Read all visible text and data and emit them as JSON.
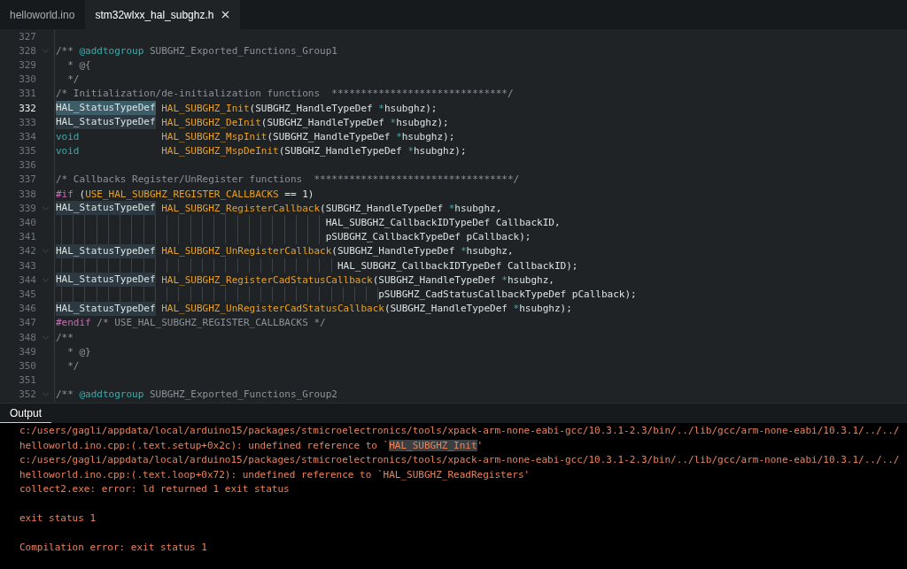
{
  "tabs": [
    {
      "label": "helloworld.ino",
      "selected": false
    },
    {
      "label": "stm32wlxx_hal_subghz.h",
      "selected": true
    }
  ],
  "editor": {
    "lines": [
      {
        "number": "327",
        "current": false,
        "fold": false
      },
      {
        "number": "328",
        "current": false,
        "fold": true,
        "tokens": [
          {
            "kind": "comment",
            "text": "/** "
          },
          {
            "kind": "tag",
            "text": "@addtogroup"
          },
          {
            "kind": "comment",
            "text": " SUBGHZ_Exported_Functions_Group1"
          }
        ]
      },
      {
        "number": "329",
        "current": false,
        "fold": false,
        "tokens": [
          {
            "kind": "comment",
            "text": "  * @{"
          }
        ]
      },
      {
        "number": "330",
        "current": false,
        "fold": false,
        "tokens": [
          {
            "kind": "comment",
            "text": "  */"
          }
        ]
      },
      {
        "number": "331",
        "current": false,
        "fold": false,
        "tokens": [
          {
            "kind": "comment",
            "text": "/* Initialization/de-initialization functions  ******************************/"
          }
        ]
      },
      {
        "number": "332",
        "current": true,
        "fold": false,
        "tokens": [
          {
            "kind": "type",
            "text": "HAL_StatusTypeDef",
            "highlighted": true
          },
          {
            "kind": "func",
            "text": " HAL_SUBGHZ_Init"
          },
          {
            "kind": "text",
            "text": "(SUBGHZ_HandleTypeDef "
          },
          {
            "kind": "op",
            "text": "*"
          },
          {
            "kind": "text",
            "text": "hsubghz);"
          }
        ]
      },
      {
        "number": "333",
        "current": false,
        "fold": false,
        "tokens": [
          {
            "kind": "type",
            "text": "HAL_StatusTypeDef",
            "highlighted": true
          },
          {
            "kind": "func",
            "text": " HAL_SUBGHZ_DeInit"
          },
          {
            "kind": "text",
            "text": "(SUBGHZ_HandleTypeDef "
          },
          {
            "kind": "op",
            "text": "*"
          },
          {
            "kind": "text",
            "text": "hsubghz);"
          }
        ]
      },
      {
        "number": "334",
        "current": false,
        "fold": false,
        "tokens": [
          {
            "kind": "keyword",
            "text": "void"
          },
          {
            "kind": "func",
            "text": "              HAL_SUBGHZ_MspInit"
          },
          {
            "kind": "text",
            "text": "(SUBGHZ_HandleTypeDef "
          },
          {
            "kind": "op",
            "text": "*"
          },
          {
            "kind": "text",
            "text": "hsubghz);"
          }
        ]
      },
      {
        "number": "335",
        "current": false,
        "fold": false,
        "tokens": [
          {
            "kind": "keyword",
            "text": "void"
          },
          {
            "kind": "func",
            "text": "              HAL_SUBGHZ_MspDeInit"
          },
          {
            "kind": "text",
            "text": "(SUBGHZ_HandleTypeDef "
          },
          {
            "kind": "op",
            "text": "*"
          },
          {
            "kind": "text",
            "text": "hsubghz);"
          }
        ]
      },
      {
        "number": "336",
        "current": false,
        "fold": false
      },
      {
        "number": "337",
        "current": false,
        "fold": false,
        "tokens": [
          {
            "kind": "comment",
            "text": "/* Callbacks Register/UnRegister functions  **********************************/"
          }
        ]
      },
      {
        "number": "338",
        "current": false,
        "fold": false,
        "tokens": [
          {
            "kind": "directive",
            "text": "#if"
          },
          {
            "kind": "text",
            "text": " ("
          },
          {
            "kind": "func",
            "text": "USE_HAL_SUBGHZ_REGISTER_CALLBACKS"
          },
          {
            "kind": "text",
            "text": " == 1)"
          }
        ]
      },
      {
        "number": "339",
        "current": false,
        "fold": true,
        "tokens": [
          {
            "kind": "type",
            "text": "HAL_StatusTypeDef",
            "highlighted": true
          },
          {
            "kind": "func",
            "text": " HAL_SUBGHZ_RegisterCallback"
          },
          {
            "kind": "text",
            "text": "(SUBGHZ_HandleTypeDef "
          },
          {
            "kind": "op",
            "text": "*"
          },
          {
            "kind": "text",
            "text": "hsubghz,"
          }
        ]
      },
      {
        "number": "340",
        "current": false,
        "fold": false,
        "tokens": [
          {
            "kind": "continuation",
            "text": "                                              HAL_SUBGHZ_CallbackIDTypeDef CallbackID,"
          }
        ]
      },
      {
        "number": "341",
        "current": false,
        "fold": false,
        "tokens": [
          {
            "kind": "continuation",
            "text": "                                              pSUBGHZ_CallbackTypeDef pCallback);"
          }
        ]
      },
      {
        "number": "342",
        "current": false,
        "fold": true,
        "tokens": [
          {
            "kind": "type",
            "text": "HAL_StatusTypeDef",
            "highlighted": true
          },
          {
            "kind": "func",
            "text": " HAL_SUBGHZ_UnRegisterCallback"
          },
          {
            "kind": "text",
            "text": "(SUBGHZ_HandleTypeDef "
          },
          {
            "kind": "op",
            "text": "*"
          },
          {
            "kind": "text",
            "text": "hsubghz,"
          }
        ]
      },
      {
        "number": "343",
        "current": false,
        "fold": false,
        "tokens": [
          {
            "kind": "continuation",
            "text": "                                                HAL_SUBGHZ_CallbackIDTypeDef CallbackID);"
          }
        ]
      },
      {
        "number": "344",
        "current": false,
        "fold": true,
        "tokens": [
          {
            "kind": "type",
            "text": "HAL_StatusTypeDef",
            "highlighted": true
          },
          {
            "kind": "func",
            "text": " HAL_SUBGHZ_RegisterCadStatusCallback"
          },
          {
            "kind": "text",
            "text": "(SUBGHZ_HandleTypeDef "
          },
          {
            "kind": "op",
            "text": "*"
          },
          {
            "kind": "text",
            "text": "hsubghz,"
          }
        ]
      },
      {
        "number": "345",
        "current": false,
        "fold": false,
        "tokens": [
          {
            "kind": "continuation",
            "text": "                                                       pSUBGHZ_CadStatusCallbackTypeDef pCallback);"
          }
        ]
      },
      {
        "number": "346",
        "current": false,
        "fold": false,
        "tokens": [
          {
            "kind": "type",
            "text": "HAL_StatusTypeDef",
            "highlighted": true
          },
          {
            "kind": "func",
            "text": " HAL_SUBGHZ_UnRegisterCadStatusCallback"
          },
          {
            "kind": "text",
            "text": "(SUBGHZ_HandleTypeDef "
          },
          {
            "kind": "op",
            "text": "*"
          },
          {
            "kind": "text",
            "text": "hsubghz);"
          }
        ]
      },
      {
        "number": "347",
        "current": false,
        "fold": false,
        "tokens": [
          {
            "kind": "directive",
            "text": "#endif"
          },
          {
            "kind": "comment",
            "text": " /* USE_HAL_SUBGHZ_REGISTER_CALLBACKS */"
          }
        ]
      },
      {
        "number": "348",
        "current": false,
        "fold": true,
        "tokens": [
          {
            "kind": "comment",
            "text": "/**"
          }
        ]
      },
      {
        "number": "349",
        "current": false,
        "fold": false,
        "tokens": [
          {
            "kind": "comment",
            "text": "  * @}"
          }
        ]
      },
      {
        "number": "350",
        "current": false,
        "fold": false,
        "tokens": [
          {
            "kind": "comment",
            "text": "  */"
          }
        ]
      },
      {
        "number": "351",
        "current": false,
        "fold": false
      },
      {
        "number": "352",
        "current": false,
        "fold": true,
        "tokens": [
          {
            "kind": "comment",
            "text": "/** "
          },
          {
            "kind": "tag",
            "text": "@addtogroup"
          },
          {
            "kind": "comment",
            "text": " SUBGHZ_Exported_Functions_Group2"
          }
        ]
      }
    ]
  },
  "output": {
    "title": "Output",
    "lines": [
      {
        "kind": "text",
        "parts": [
          {
            "text": "c:/users/gagli/appdata/local/arduino15/packages/stmicroelectronics/tools/xpack-arm-none-eabi-gcc/10.3.1-2.3/bin/../lib/gcc/arm-none-eabi/10.3.1/../../",
            "highlighted": false
          }
        ]
      },
      {
        "kind": "text",
        "parts": [
          {
            "text": "helloworld.ino.cpp:(.text.setup+0x2c): undefined reference to `",
            "highlighted": false
          },
          {
            "text": "HAL_SUBGHZ_Init",
            "highlighted": true
          },
          {
            "text": "'",
            "highlighted": false
          }
        ]
      },
      {
        "kind": "text",
        "parts": [
          {
            "text": "c:/users/gagli/appdata/local/arduino15/packages/stmicroelectronics/tools/xpack-arm-none-eabi-gcc/10.3.1-2.3/bin/../lib/gcc/arm-none-eabi/10.3.1/../../",
            "highlighted": false
          }
        ]
      },
      {
        "kind": "text",
        "parts": [
          {
            "text": "helloworld.ino.cpp:(.text.loop+0x72): undefined reference to `HAL_SUBGHZ_ReadRegisters'",
            "highlighted": false
          }
        ]
      },
      {
        "kind": "text",
        "parts": [
          {
            "text": "collect2.exe: error: ld returned 1 exit status",
            "highlighted": false
          }
        ]
      },
      {
        "kind": "blank"
      },
      {
        "kind": "text",
        "parts": [
          {
            "text": "exit status 1",
            "highlighted": false
          }
        ]
      },
      {
        "kind": "blank"
      },
      {
        "kind": "text",
        "parts": [
          {
            "text": "Compilation error: exit status 1",
            "highlighted": false
          }
        ]
      }
    ]
  }
}
